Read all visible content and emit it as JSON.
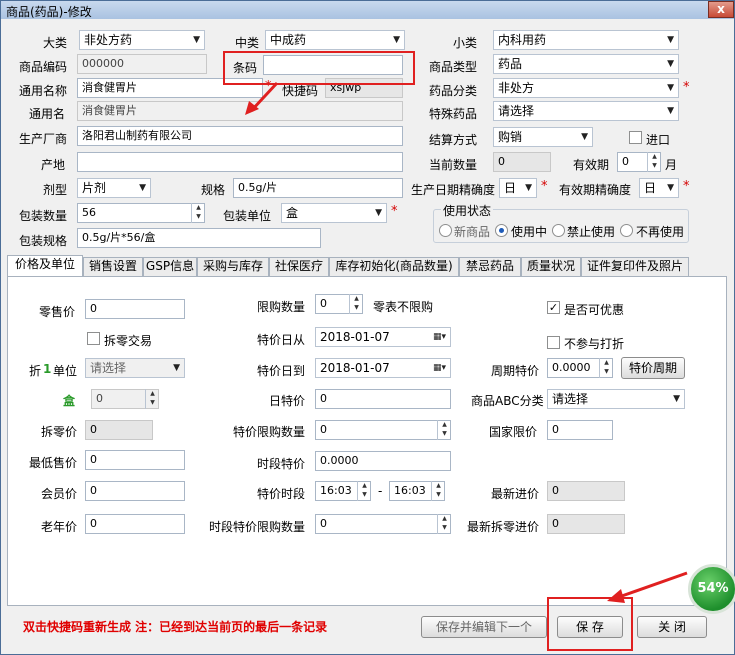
{
  "window": {
    "title": "商品(药品)-修改",
    "close_label": "x"
  },
  "top": {
    "dalei_label": "大类",
    "dalei_value": "非处方药",
    "zhonglei_label": "中类",
    "zhonglei_value": "中成药",
    "xiaolei_label": "小类",
    "xiaolei_value": "内科用药",
    "code_label": "商品编码",
    "code_value": "000000",
    "barcode_label": "条码",
    "barcode_value": "",
    "type_label": "商品类型",
    "type_value": "药品",
    "common_name_label": "通用名称",
    "common_name_value": "消食健胃片",
    "shortcut_label": "快捷码",
    "shortcut_value": "xsjwp",
    "drug_class_label": "药品分类",
    "drug_class_value": "非处方",
    "common_name2_label": "通用名",
    "common_name2_value": "消食健胃片",
    "special_label": "特殊药品",
    "special_value": "请选择",
    "maker_label": "生产厂商",
    "maker_value": "洛阳君山制药有限公司",
    "settle_label": "结算方式",
    "settle_value": "购销",
    "import_label": "进口",
    "origin_label": "产地",
    "origin_value": "",
    "qty_label": "当前数量",
    "qty_value": "0",
    "valid_label": "有效期",
    "valid_value": "0",
    "month_label": "月",
    "form_label": "剂型",
    "form_value": "片剂",
    "spec_label": "规格",
    "spec_value": "0.5g/片",
    "prod_prec_label": "生产日期精确度",
    "prod_prec_value": "日",
    "valid_prec_label": "有效期精确度",
    "valid_prec_value": "日",
    "pack_qty_label": "包装数量",
    "pack_qty_value": "56",
    "pack_unit_label": "包装单位",
    "pack_unit_value": "盒",
    "pack_spec_label": "包装规格",
    "pack_spec_value": "0.5g/片*56/盒",
    "usage_title": "使用状态",
    "usage_options": [
      "新商品",
      "使用中",
      "禁止使用",
      "不再使用"
    ],
    "required_mark": "*"
  },
  "tabs": [
    "价格及单位",
    "销售设置",
    "GSP信息",
    "采购与库存",
    "社保医疗",
    "库存初始化(商品数量)",
    "禁忌药品",
    "质量状况",
    "证件复印件及照片"
  ],
  "panel": {
    "retail_label": "零售价",
    "retail_value": "0",
    "limit_qty_label": "限购数量",
    "limit_qty_value": "0",
    "limit_qty_note": "零表不限购",
    "discount_check_label": "是否可优惠",
    "split_label": "拆零交易",
    "special_from_label": "特价日从",
    "special_from_value": "2018-01-07",
    "no_discount_label": "不参与打折",
    "fold_label_a": "折",
    "fold_num": "1",
    "fold_label_b": "单位",
    "fold_unit_value": "请选择",
    "special_to_label": "特价日到",
    "special_to_value": "2018-01-07",
    "cycle_label": "周期特价",
    "cycle_value": "0.0000",
    "cycle_button": "特价周期",
    "box_label": "盒",
    "box_value": "0",
    "day_special_label": "日特价",
    "day_special_value": "0",
    "abc_label": "商品ABC分类",
    "abc_value": "请选择",
    "split_price_label": "拆零价",
    "split_price_value": "0",
    "special_limit_label": "特价限购数量",
    "special_limit_value": "0",
    "national_label": "国家限价",
    "national_value": "0",
    "min_price_label": "最低售价",
    "min_price_value": "0",
    "period_special_label": "时段特价",
    "period_special_value": "0.0000",
    "member_label": "会员价",
    "member_value": "0",
    "period_time_label": "特价时段",
    "period_from": "16:03",
    "period_dash": "-",
    "period_to": "16:03",
    "latest_in_label": "最新进价",
    "latest_in_value": "0",
    "senior_label": "老年价",
    "senior_value": "0",
    "period_limit_label": "时段特价限购数量",
    "period_limit_value": "0",
    "latest_split_label": "最新拆零进价",
    "latest_split_value": "0"
  },
  "footer": {
    "message": "双击快捷码重新生成  注：已经到达当前页的最后一条记录",
    "save_next": "保存并编辑下一个",
    "save": "保 存",
    "close": "关 闭"
  },
  "progress_badge": "54%"
}
